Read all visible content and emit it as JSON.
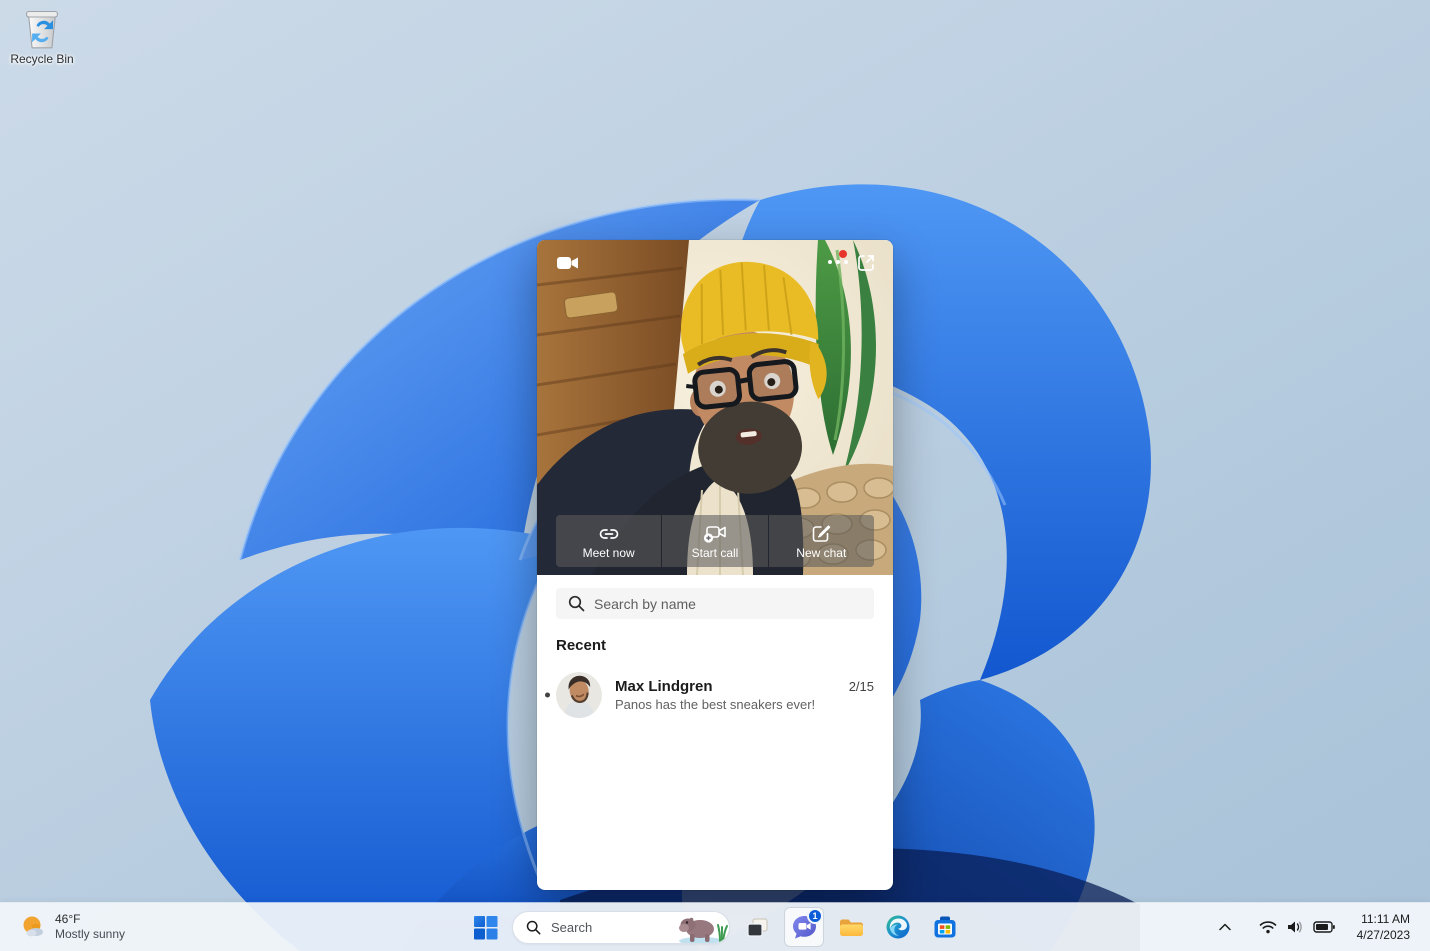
{
  "desktop": {
    "recycle_bin_label": "Recycle Bin"
  },
  "teams_flyout": {
    "actions": [
      {
        "label": "Meet now",
        "icon": "link-icon"
      },
      {
        "label": "Start call",
        "icon": "video-add-icon"
      },
      {
        "label": "New chat",
        "icon": "compose-icon"
      }
    ],
    "search_placeholder": "Search by name",
    "recent_heading": "Recent",
    "recent_items": [
      {
        "name": "Max Lindgren",
        "message": "Panos has the best sneakers ever!",
        "date": "2/15",
        "unread": true
      }
    ]
  },
  "taskbar": {
    "weather": {
      "temperature": "46°F",
      "condition": "Mostly sunny"
    },
    "search_label": "Search",
    "teams_badge": "1",
    "clock": {
      "time": "11:11 AM",
      "date": "4/27/2023"
    }
  },
  "colors": {
    "accent_blue": "#0b5cd7",
    "teams_purple": "#6b71e3",
    "notification_red": "#e8352b",
    "wallpaper_blue": "#1f6ae0",
    "taskbar_bg": "#f1f5fa"
  }
}
